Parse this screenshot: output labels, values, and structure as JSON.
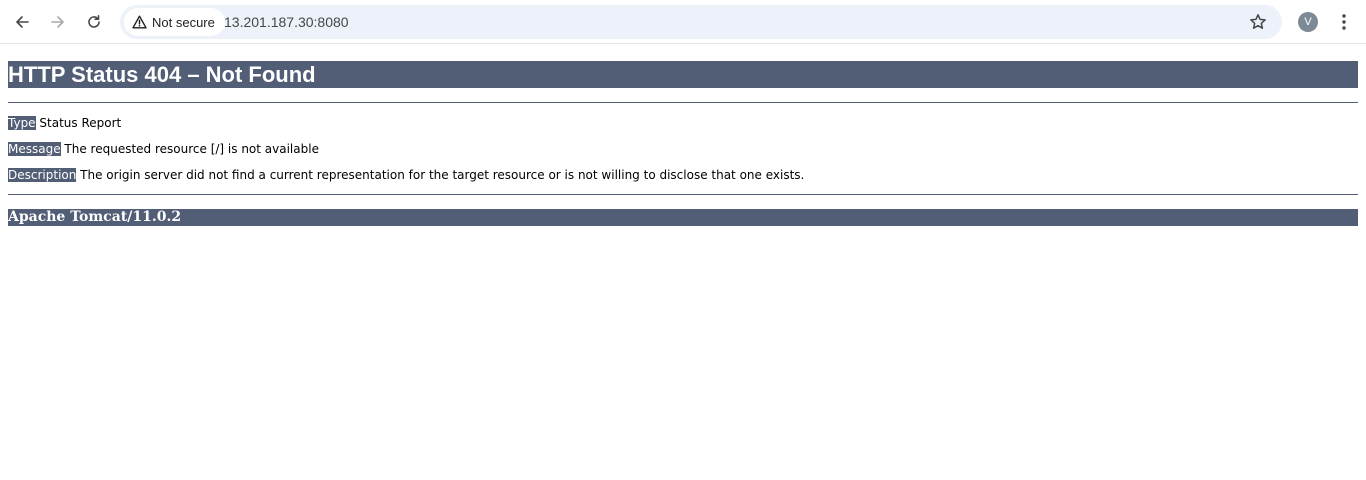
{
  "browser": {
    "security_label": "Not secure",
    "url": "13.201.187.30:8080",
    "profile_initial": "V",
    "icons": {
      "back": "back-arrow-icon",
      "forward": "forward-arrow-icon",
      "reload": "reload-icon",
      "warning": "warning-icon",
      "bookmark": "star-icon",
      "menu": "kebab-menu-icon"
    }
  },
  "error_page": {
    "heading": "HTTP Status 404 – Not Found",
    "type_label": "Type",
    "type_value": "Status Report",
    "message_label": "Message",
    "message_value": "The requested resource [/] is not available",
    "description_label": "Description",
    "description_value": "The origin server did not find a current representation for the target resource or is not willing to disclose that one exists.",
    "server_info": "Apache Tomcat/11.0.2"
  },
  "colors": {
    "tomcat_header_bg": "#525d76",
    "omnibox_bg": "#edf2fa",
    "avatar_bg": "#7d8a96"
  }
}
